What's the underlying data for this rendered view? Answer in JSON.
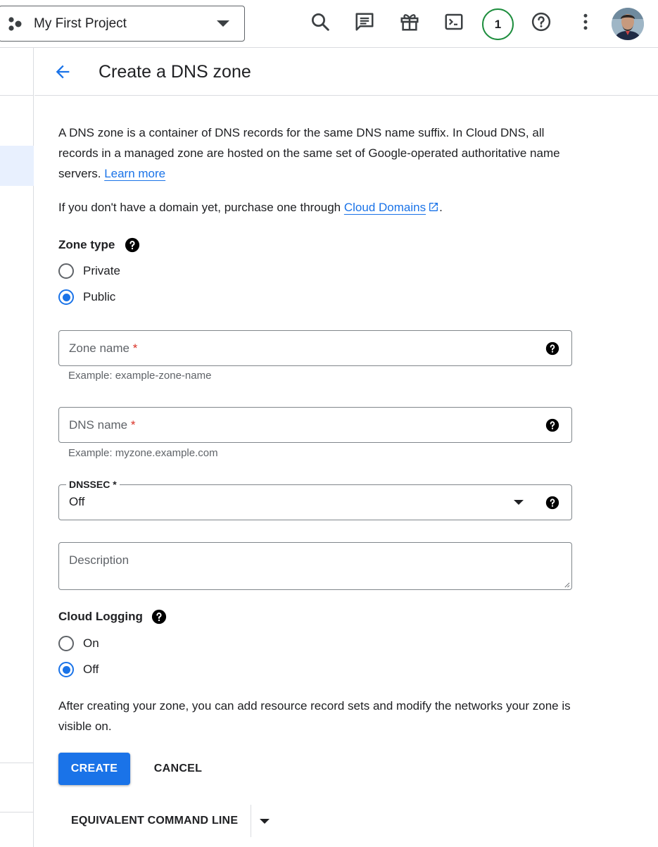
{
  "topbar": {
    "project_name": "My First Project",
    "notification_count": "1",
    "icons": [
      "search-icon",
      "feedback-icon",
      "gift-icon",
      "cloud-shell-icon",
      "help-icon",
      "more-vert-icon"
    ]
  },
  "header": {
    "title": "Create a DNS zone"
  },
  "intro": {
    "text": "A DNS zone is a container of DNS records for the same DNS name suffix. In Cloud DNS, all records in a managed zone are hosted on the same set of Google-operated authoritative name servers. ",
    "learn_more": "Learn more",
    "domains_prefix": "If you don't have a domain yet, purchase one through ",
    "domains_link": "Cloud Domains",
    "domains_suffix": "."
  },
  "zone_type": {
    "label": "Zone type",
    "options": [
      {
        "label": "Private",
        "checked": false
      },
      {
        "label": "Public",
        "checked": true
      }
    ]
  },
  "zone_name": {
    "placeholder": "Zone name",
    "required": "*",
    "hint": "Example: example-zone-name"
  },
  "dns_name": {
    "placeholder": "DNS name",
    "required": "*",
    "hint": "Example: myzone.example.com"
  },
  "dnssec": {
    "label": "DNSSEC *",
    "value": "Off"
  },
  "description": {
    "placeholder": "Description"
  },
  "cloud_logging": {
    "label": "Cloud Logging",
    "options": [
      {
        "label": "On",
        "checked": false
      },
      {
        "label": "Off",
        "checked": true
      }
    ]
  },
  "after_text": "After creating your zone, you can add resource record sets and modify the networks your zone is visible on.",
  "actions": {
    "create": "CREATE",
    "cancel": "CANCEL",
    "equivalent": "EQUIVALENT COMMAND LINE"
  },
  "colors": {
    "accent": "#1a73e8",
    "required": "#d93025",
    "notification_ring": "#1e8e3e"
  }
}
